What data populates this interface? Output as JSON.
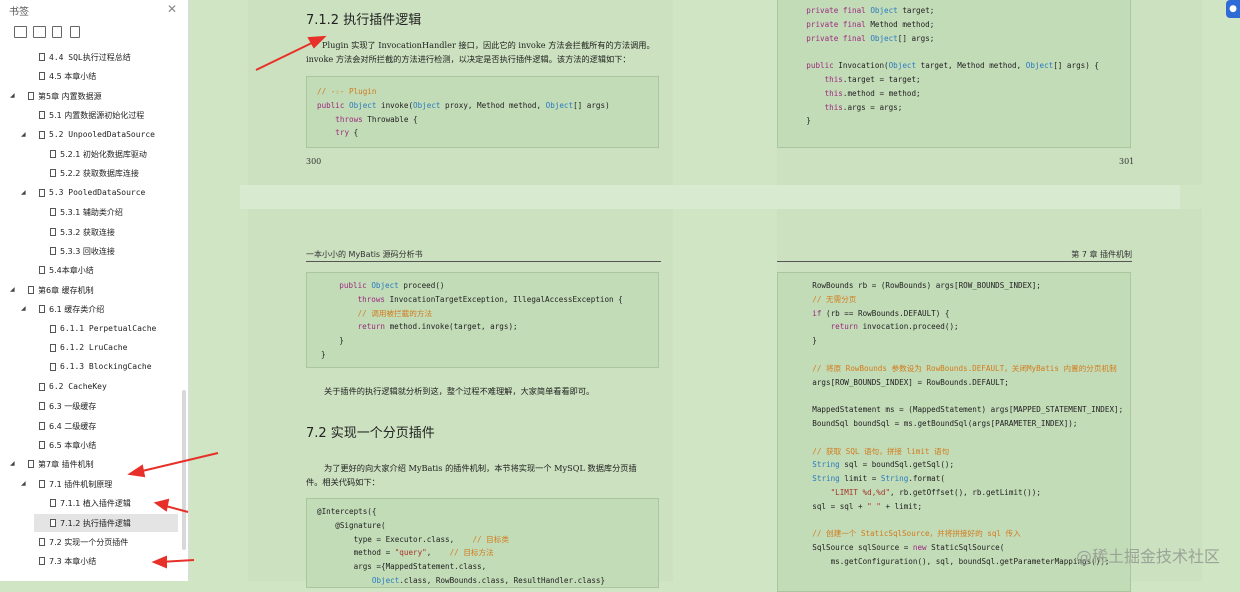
{
  "sidebar": {
    "title": "书签",
    "tree": [
      {
        "indent": 1,
        "exp": "",
        "label": "4.4 SQL执行过程总结",
        "mono": true
      },
      {
        "indent": 1,
        "exp": "",
        "label": "4.5 本章小结",
        "mono": false
      },
      {
        "indent": 0,
        "exp": "◢",
        "label": "第5章 内置数据源",
        "mono": false
      },
      {
        "indent": 1,
        "exp": "",
        "label": "5.1 内置数据源初始化过程",
        "mono": false
      },
      {
        "indent": 1,
        "exp": "◢",
        "label": "5.2 UnpooledDataSource",
        "mono": true
      },
      {
        "indent": 2,
        "exp": "",
        "label": "5.2.1 初始化数据库驱动",
        "mono": false
      },
      {
        "indent": 2,
        "exp": "",
        "label": "5.2.2 获取数据库连接",
        "mono": false
      },
      {
        "indent": 1,
        "exp": "◢",
        "label": "5.3 PooledDataSource",
        "mono": true
      },
      {
        "indent": 2,
        "exp": "",
        "label": "5.3.1 辅助类介绍",
        "mono": false
      },
      {
        "indent": 2,
        "exp": "",
        "label": "5.3.2 获取连接",
        "mono": false
      },
      {
        "indent": 2,
        "exp": "",
        "label": "5.3.3 回收连接",
        "mono": false
      },
      {
        "indent": 1,
        "exp": "",
        "label": "5.4本章小结",
        "mono": false
      },
      {
        "indent": 0,
        "exp": "◢",
        "label": "第6章 缓存机制",
        "mono": false
      },
      {
        "indent": 1,
        "exp": "◢",
        "label": "6.1 缓存类介绍",
        "mono": false
      },
      {
        "indent": 2,
        "exp": "",
        "label": "6.1.1 PerpetualCache",
        "mono": true
      },
      {
        "indent": 2,
        "exp": "",
        "label": "6.1.2 LruCache",
        "mono": true
      },
      {
        "indent": 2,
        "exp": "",
        "label": "6.1.3 BlockingCache",
        "mono": true
      },
      {
        "indent": 1,
        "exp": "",
        "label": "6.2 CacheKey",
        "mono": true
      },
      {
        "indent": 1,
        "exp": "",
        "label": "6.3 一级缓存",
        "mono": false
      },
      {
        "indent": 1,
        "exp": "",
        "label": "6.4 二级缓存",
        "mono": false
      },
      {
        "indent": 1,
        "exp": "",
        "label": "6.5 本章小结",
        "mono": false
      },
      {
        "indent": 0,
        "exp": "◢",
        "label": "第7章 插件机制",
        "mono": false
      },
      {
        "indent": 1,
        "exp": "◢",
        "label": "7.1 插件机制原理",
        "mono": false
      },
      {
        "indent": 2,
        "exp": "",
        "label": "7.1.1 植入插件逻辑",
        "mono": false
      },
      {
        "indent": 2,
        "exp": "",
        "label": "7.1.2 执行插件逻辑",
        "mono": false,
        "selected": true
      },
      {
        "indent": 1,
        "exp": "",
        "label": "7.2 实现一个分页插件",
        "mono": false
      },
      {
        "indent": 1,
        "exp": "",
        "label": "7.3 本章小结",
        "mono": false
      }
    ]
  },
  "page300": {
    "heading": "7.1.2 执行插件逻辑",
    "para_line1": "Plugin 实现了 InvocationHandler 接口，因此它的 invoke 方法会拦截所有的方法调用。",
    "para_line2": "invoke 方法会对所拦截的方法进行检测，以决定是否执行插件逻辑。该方法的逻辑如下：",
    "code": [
      "// -☆- Plugin",
      "public Object invoke(Object proxy, Method method, Object[] args)",
      "    throws Throwable {",
      "    try {"
    ],
    "page_number": "300"
  },
  "page301": {
    "code": [
      "    private final Object target;",
      "    private final Method method;",
      "    private final Object[] args;",
      "",
      "    public Invocation(Object target, Method method, Object[] args) {",
      "        this.target = target;",
      "        this.method = method;",
      "        this.args = args;",
      "    }"
    ],
    "page_number": "301"
  },
  "page302": {
    "header": "一本小小的 MyBatis 源码分析书",
    "code1": [
      "    public Object proceed()",
      "        throws InvocationTargetException, IllegalAccessException {",
      "        // 调用被拦截的方法",
      "        return method.invoke(target, args);",
      "    }",
      "}"
    ],
    "para1": "关于插件的执行逻辑就分析到这，整个过程不难理解，大家简单看看即可。",
    "heading": "7.2 实现一个分页插件",
    "para2_line1": "为了更好的向大家介绍 MyBatis 的插件机制，本节将实现一个 MySQL 数据库分页插",
    "para2_line2": "件。相关代码如下：",
    "code2": [
      "@Intercepts({",
      "    @Signature(",
      "        type = Executor.class,    // 目标类",
      "        method = \"query\",    // 目标方法",
      "        args ={MappedStatement.class,",
      "            Object.class, RowBounds.class, ResultHandler.class}"
    ]
  },
  "page303": {
    "header": "第 7 章 插件机制",
    "code": [
      "    RowBounds rb = (RowBounds) args[ROW_BOUNDS_INDEX];",
      "    // 无需分页",
      "    if (rb == RowBounds.DEFAULT) {",
      "        return invocation.proceed();",
      "    }",
      "",
      "    // 将原 RowBounds 参数设为 RowBounds.DEFAULT，关闭MyBatis 内置的分页机制",
      "    args[ROW_BOUNDS_INDEX] = RowBounds.DEFAULT;",
      "",
      "    MappedStatement ms = (MappedStatement) args[MAPPED_STATEMENT_INDEX];",
      "    BoundSql boundSql = ms.getBoundSql(args[PARAMETER_INDEX]);",
      "",
      "    // 获取 SQL 语句，拼接 limit 语句",
      "    String sql = boundSql.getSql();",
      "    String limit = String.format(",
      "        \"LIMIT %d,%d\", rb.getOffset(), rb.getLimit());",
      "    sql = sql + \" \" + limit;",
      "",
      "    // 创建一个 StaticSqlSource，并将拼接好的 sql 传入",
      "    SqlSource sqlSource = new StaticSqlSource(",
      "        ms.getConfiguration(), sql, boundSql.getParameterMappings());"
    ]
  },
  "watermark": "@稀土掘金技术社区",
  "colors": {
    "arrow": "#e8302a",
    "keyword": "#9c2a7f",
    "type": "#2b7bbf",
    "comment": "#d27b1c"
  }
}
